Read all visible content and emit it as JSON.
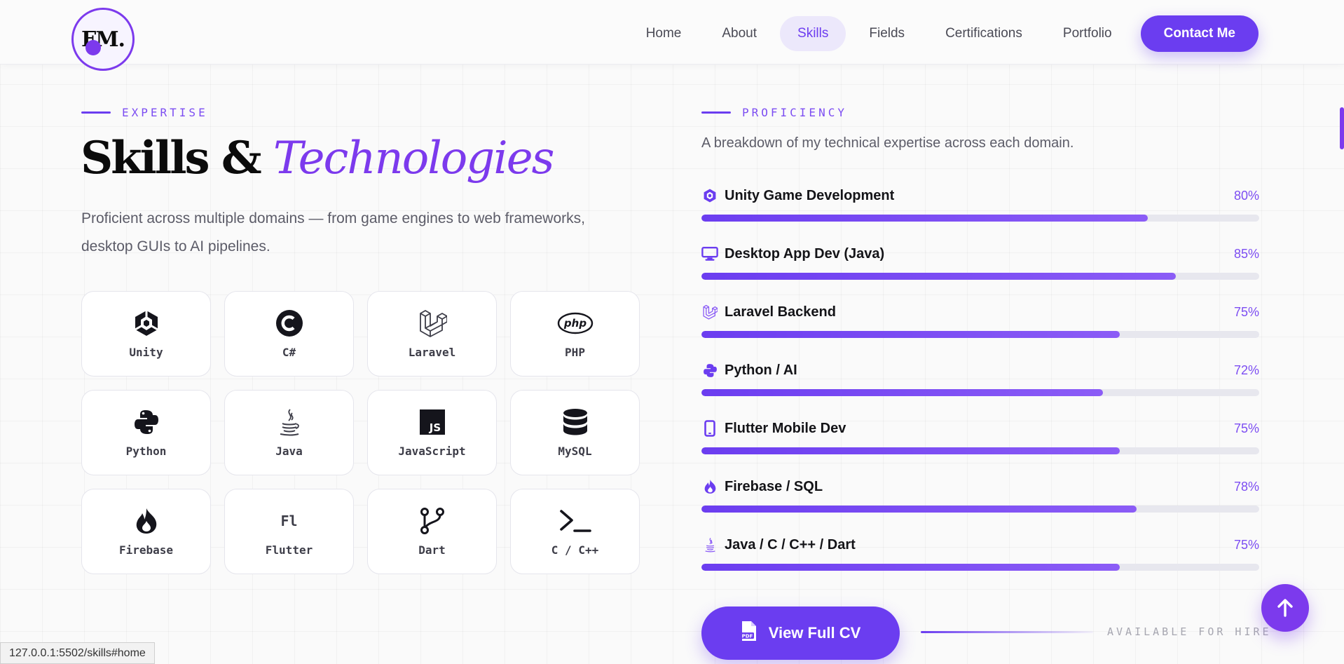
{
  "logo": {
    "text": "FM."
  },
  "nav": {
    "links": [
      {
        "label": "Home"
      },
      {
        "label": "About"
      },
      {
        "label": "Skills",
        "active": true
      },
      {
        "label": "Fields"
      },
      {
        "label": "Certifications"
      },
      {
        "label": "Portfolio"
      }
    ],
    "contact_label": "Contact Me"
  },
  "expertise": {
    "eyebrow": "EXPERTISE",
    "title_main": "Skills &",
    "title_accent": "Technologies",
    "lead": "Proficient across multiple domains — from game engines to web frameworks, desktop GUIs to AI pipelines."
  },
  "tech_cards": [
    {
      "label": "Unity",
      "icon": "unity-icon"
    },
    {
      "label": "C#",
      "icon": "csharp-icon"
    },
    {
      "label": "Laravel",
      "icon": "laravel-icon"
    },
    {
      "label": "PHP",
      "icon": "php-icon"
    },
    {
      "label": "Python",
      "icon": "python-icon"
    },
    {
      "label": "Java",
      "icon": "java-icon"
    },
    {
      "label": "JavaScript",
      "icon": "javascript-icon"
    },
    {
      "label": "MySQL",
      "icon": "database-icon"
    },
    {
      "label": "Firebase",
      "icon": "fire-icon"
    },
    {
      "label": "Flutter",
      "icon": "flutter-icon",
      "icon_text": "Fl"
    },
    {
      "label": "Dart",
      "icon": "git-branch-icon"
    },
    {
      "label": "C / C++",
      "icon": "terminal-icon"
    }
  ],
  "proficiency": {
    "eyebrow": "PROFICIENCY",
    "subtitle": "A breakdown of my technical expertise across each domain.",
    "skills": [
      {
        "name": "Unity Game Development",
        "pct_label": "80%",
        "value": 0.8,
        "icon": "unity-icon"
      },
      {
        "name": "Desktop App Dev (Java)",
        "pct_label": "85%",
        "value": 0.85,
        "icon": "monitor-icon"
      },
      {
        "name": "Laravel Backend",
        "pct_label": "75%",
        "value": 0.75,
        "icon": "laravel-icon"
      },
      {
        "name": "Python / AI",
        "pct_label": "72%",
        "value": 0.72,
        "icon": "python-icon"
      },
      {
        "name": "Flutter Mobile Dev",
        "pct_label": "75%",
        "value": 0.75,
        "icon": "mobile-icon"
      },
      {
        "name": "Firebase / SQL",
        "pct_label": "78%",
        "value": 0.78,
        "icon": "fire-icon"
      },
      {
        "name": "Java / C / C++ / Dart",
        "pct_label": "75%",
        "value": 0.75,
        "icon": "java-icon"
      }
    ]
  },
  "cv_button": {
    "label": "View Full CV",
    "icon": "pdf-file-icon"
  },
  "hire": {
    "text": "AVAILABLE FOR HIRE"
  },
  "status_bar": {
    "url": "127.0.0.1:5502/skills#home"
  },
  "colors": {
    "accent": "#6b3df0",
    "accent_light": "#ece8fb",
    "text_dark": "#121212",
    "text_muted": "#5c5c68"
  }
}
